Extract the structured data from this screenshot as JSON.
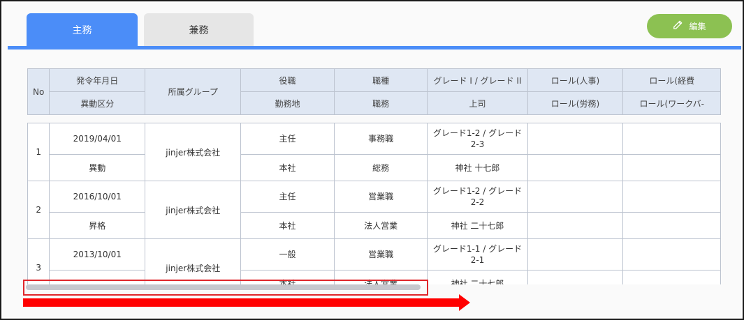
{
  "tabs": [
    {
      "label": "主務",
      "active": true
    },
    {
      "label": "兼務",
      "active": false
    }
  ],
  "edit_button": {
    "label": "編集"
  },
  "header": {
    "no": "No",
    "row1": [
      "発令年月日",
      "所属グループ",
      "役職",
      "職種",
      "グレード I / グレード II",
      "ロール(人事)",
      "ロール(経費"
    ],
    "row2": [
      "異動区分",
      "勤務地",
      "職務",
      "上司",
      "ロール(労務)",
      "ロール(ワークバ-"
    ]
  },
  "rows": [
    {
      "no": "1",
      "date": "2019/04/01",
      "type": "異動",
      "group": "jinjer株式会社",
      "position": "主任",
      "location": "本社",
      "job_type": "事務職",
      "duty": "総務",
      "grade": "グレード1-2 / グレード2-3",
      "boss": "神社 十七郎",
      "role_hr": "",
      "role_labor": "",
      "role_exp": "",
      "role_work": ""
    },
    {
      "no": "2",
      "date": "2016/10/01",
      "type": "昇格",
      "group": "jinjer株式会社",
      "position": "主任",
      "location": "本社",
      "job_type": "営業職",
      "duty": "法人営業",
      "grade": "グレード1-2 / グレード2-2",
      "boss": "神社 二十七郎",
      "role_hr": "",
      "role_labor": "",
      "role_exp": "",
      "role_work": ""
    },
    {
      "no": "3",
      "date": "2013/10/01",
      "type": "",
      "group": "jinjer株式会社",
      "position": "一般",
      "location": "本社",
      "job_type": "営業職",
      "duty": "法人営業",
      "grade": "グレード1-1 / グレード2-1",
      "boss": "神社 二十七郎",
      "role_hr": "",
      "role_labor": "",
      "role_exp": "",
      "role_work": ""
    }
  ],
  "colors": {
    "tab_active": "#4b8df8",
    "tab_inactive": "#e6e6e6",
    "edit": "#8cc152",
    "header_bg": "#dfe7f3",
    "highlight": "#e0252a",
    "arrow": "#ff0000"
  }
}
